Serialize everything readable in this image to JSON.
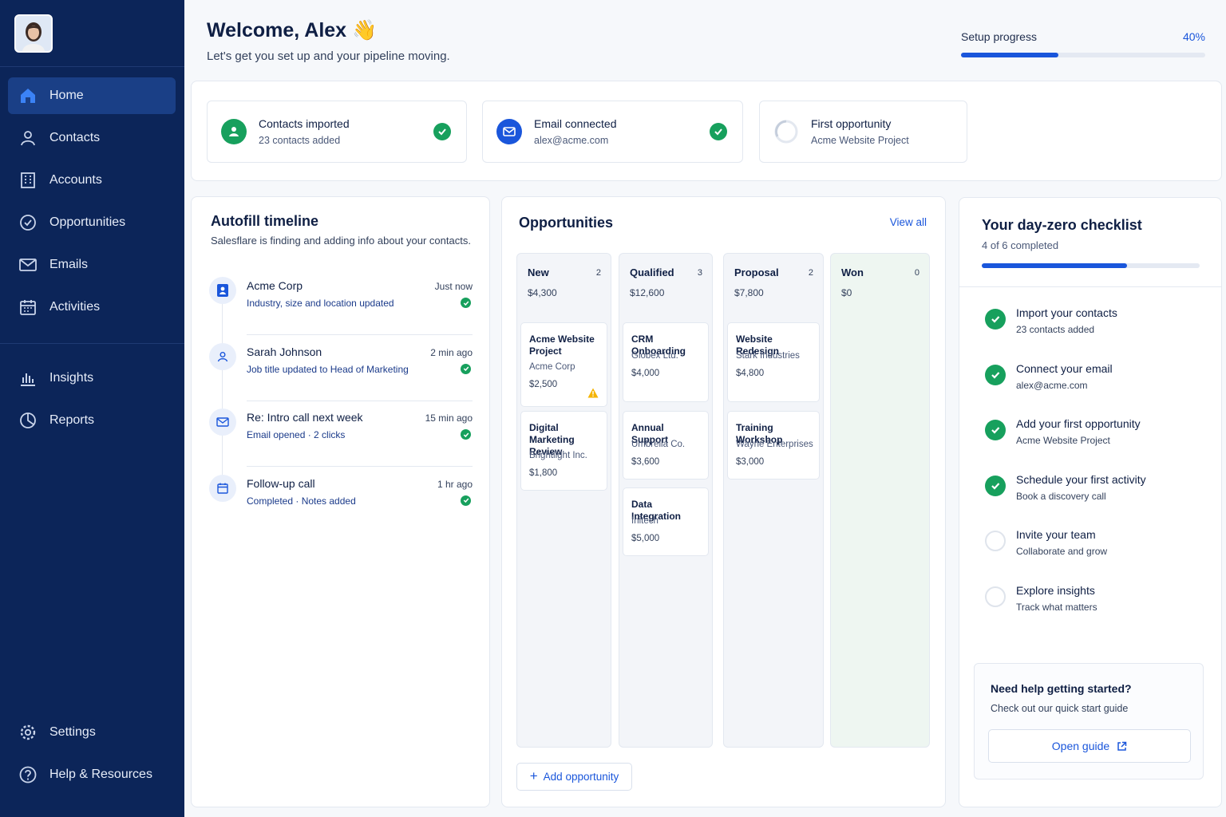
{
  "colors": {
    "sidebar": "#0c2559",
    "accent": "#1a56db",
    "success": "#17a05d",
    "warning": "#f5b400"
  },
  "sidebar": {
    "nav": [
      {
        "label": "Home",
        "icon": "home-icon",
        "active": true
      },
      {
        "label": "Contacts",
        "icon": "user-icon"
      },
      {
        "label": "Accounts",
        "icon": "building-icon"
      },
      {
        "label": "Opportunities",
        "icon": "target-icon"
      },
      {
        "label": "Emails",
        "icon": "envelope-icon"
      },
      {
        "label": "Activities",
        "icon": "calendar-icon"
      }
    ],
    "nav2": [
      {
        "label": "Insights",
        "icon": "bar-chart-icon"
      },
      {
        "label": "Reports",
        "icon": "pie-chart-icon"
      }
    ],
    "footer": [
      {
        "label": "Settings",
        "icon": "gear-icon"
      },
      {
        "label": "Help & Resources",
        "icon": "help-circle-icon"
      }
    ]
  },
  "header": {
    "title": "Welcome, Alex",
    "emoji": "👋",
    "subtitle": "Let's get you set up and your pipeline moving.",
    "setup_label": "Setup progress",
    "setup_pct_label": "40%",
    "setup_progress": 0.4
  },
  "steps": [
    {
      "title": "Contacts imported",
      "subtitle": "23 contacts added",
      "done": true
    },
    {
      "title": "Email connected",
      "subtitle": "alex@acme.com",
      "done": true
    },
    {
      "title": "First opportunity",
      "subtitle": "Acme Website Project",
      "done": false
    }
  ],
  "timeline": {
    "title": "Autofill timeline",
    "subtitle": "Salesflare is finding and adding info about your contacts.",
    "items": [
      {
        "title": "Acme Corp",
        "subtitle": "Industry, size and location updated",
        "time": "Just now",
        "icon": "company-badge-icon"
      },
      {
        "title": "Sarah Johnson",
        "subtitle": "Job title updated to Head of Marketing",
        "time": "2 min ago",
        "icon": "user-icon"
      },
      {
        "title": "Re: Intro call next week",
        "subtitle": "Email opened · 2 clicks",
        "time": "15 min ago",
        "icon": "envelope-icon"
      },
      {
        "title": "Follow-up call",
        "subtitle": "Completed · Notes added",
        "time": "1 hr ago",
        "icon": "calendar-icon"
      }
    ]
  },
  "opportunities": {
    "title": "Opportunities",
    "view_all": "View all",
    "add_label": "Add opportunity",
    "columns": [
      {
        "name": "New",
        "count": "2",
        "total": "$4,300",
        "cards": [
          {
            "title": "Acme Website Project",
            "company": "Acme Corp",
            "value": "$2,500",
            "warning": true
          },
          {
            "title": "Digital Marketing Review",
            "company": "Brightlight Inc.",
            "value": "$1,800"
          }
        ]
      },
      {
        "name": "Qualified",
        "count": "3",
        "total": "$12,600",
        "cards": [
          {
            "title": "CRM Onboarding",
            "company": "Globex Ltd.",
            "value": "$4,000"
          },
          {
            "title": "Annual Support",
            "company": "Umbrella Co.",
            "value": "$3,600"
          },
          {
            "title": "Data Integration",
            "company": "Initech",
            "value": "$5,000"
          }
        ]
      },
      {
        "name": "Proposal",
        "count": "2",
        "total": "$7,800",
        "cards": [
          {
            "title": "Website Redesign",
            "company": "Stark Industries",
            "value": "$4,800"
          },
          {
            "title": "Training Workshop",
            "company": "Wayne Enterprises",
            "value": "$3,000"
          }
        ]
      },
      {
        "name": "Won",
        "count": "0",
        "total": "$0",
        "cards": []
      }
    ]
  },
  "checklist": {
    "title": "Your day-zero checklist",
    "subtitle": "4 of 6 completed",
    "progress": 0.667,
    "items": [
      {
        "title": "Import your contacts",
        "subtitle": "23 contacts added",
        "done": true
      },
      {
        "title": "Connect your email",
        "subtitle": "alex@acme.com",
        "done": true
      },
      {
        "title": "Add your first opportunity",
        "subtitle": "Acme Website Project",
        "done": true
      },
      {
        "title": "Schedule your first activity",
        "subtitle": "Book a discovery call",
        "done": true
      },
      {
        "title": "Invite your team",
        "subtitle": "Collaborate and grow",
        "done": false
      },
      {
        "title": "Explore insights",
        "subtitle": "Track what matters",
        "done": false
      }
    ],
    "help_title": "Need help getting started?",
    "help_subtitle": "Check out our quick start guide",
    "guide_label": "Open guide"
  }
}
